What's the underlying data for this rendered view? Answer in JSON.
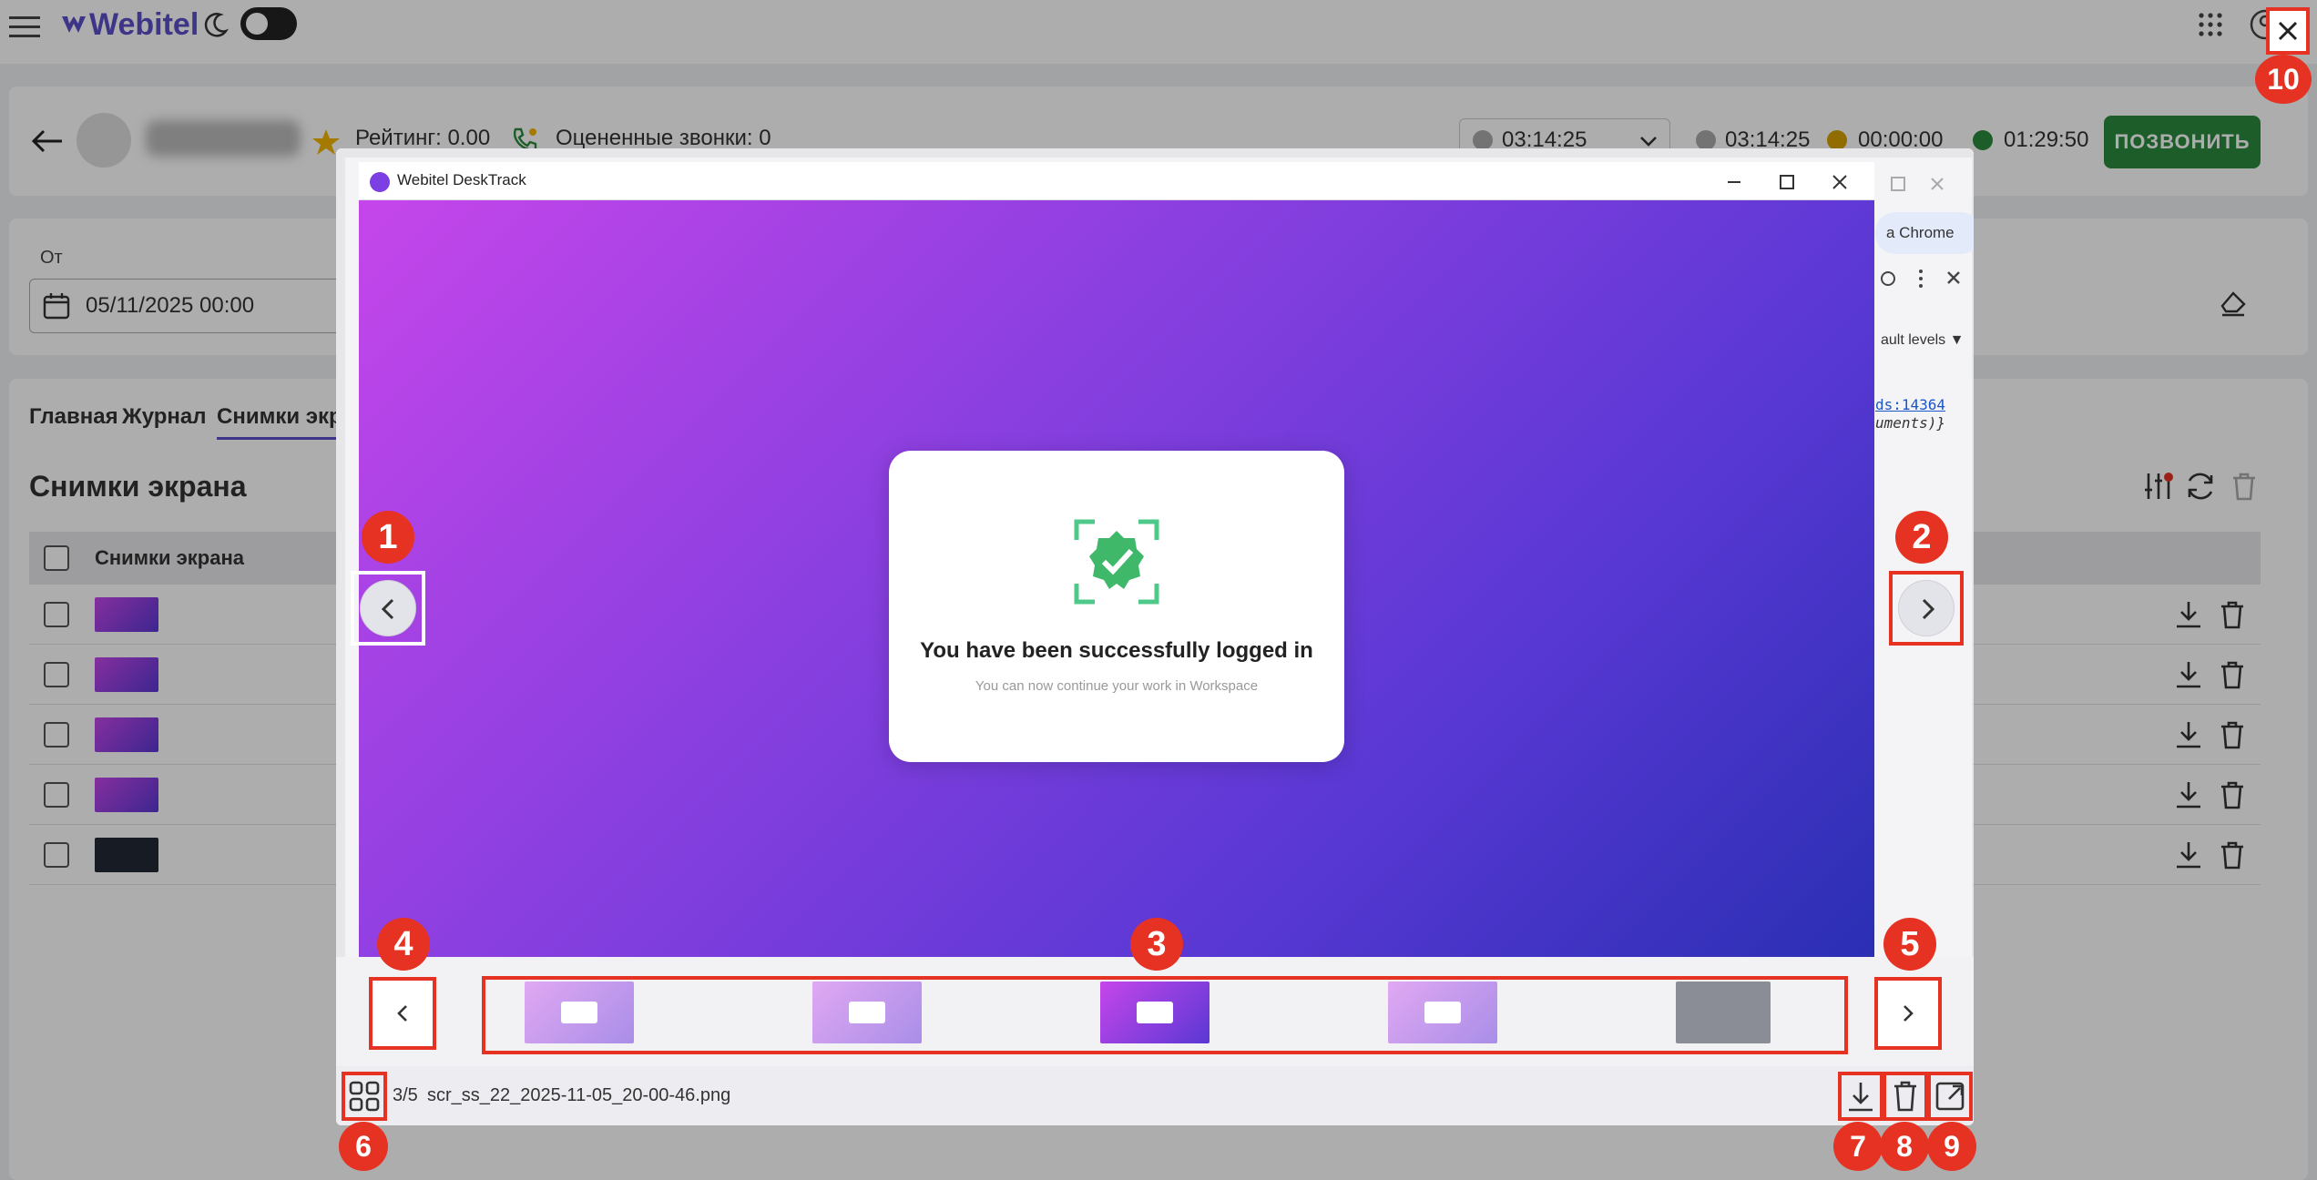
{
  "app": {
    "logo_text": "Webitel"
  },
  "profile": {
    "rating_label": "Рейтинг: 0.00",
    "rated_calls_label": "Оцененные звонки: 0",
    "timer_select_value": "03:14:25",
    "timer_gray": "03:14:25",
    "timer_yellow": "00:00:00",
    "timer_green": "01:29:50",
    "call_button": "ПОЗВОНИТЬ"
  },
  "filters": {
    "from_label": "От",
    "from_value": "05/11/2025 00:00"
  },
  "tabs": [
    {
      "label": "Главная"
    },
    {
      "label": "Журнал"
    },
    {
      "label": "Снимки экра",
      "active": true
    }
  ],
  "section": {
    "title": "Снимки экрана",
    "column_header": "Снимки экрана",
    "rows": [
      {
        "thumb": "purple"
      },
      {
        "thumb": "purple"
      },
      {
        "thumb": "purple"
      },
      {
        "thumb": "purple"
      },
      {
        "thumb": "dark"
      }
    ]
  },
  "viewer": {
    "background_window": {
      "chrome_tag": "a Chrome",
      "levels_label": "ault levels ▼",
      "code_link": "ds:14364",
      "code_text": "uments)}"
    },
    "window_title": "Webitel DeskTrack",
    "success_title": "You have been successfully logged in",
    "success_subtitle": "You can now continue your work in Workspace",
    "counter": "3/5",
    "file_name": "scr_ss_22_2025-11-05_20-00-46.png",
    "thumbnails": [
      {
        "active": false
      },
      {
        "active": false
      },
      {
        "active": true
      },
      {
        "active": false
      },
      {
        "active": false,
        "dark": true
      }
    ],
    "callouts": [
      "1",
      "2",
      "3",
      "4",
      "5",
      "6",
      "7",
      "8",
      "9",
      "10"
    ]
  },
  "colors": {
    "accent": "#5a4fc8",
    "callout_red": "#e53222",
    "call_green": "#2b8a3e",
    "gradient_start": "#c546ea",
    "gradient_end": "#2a2fb4"
  }
}
